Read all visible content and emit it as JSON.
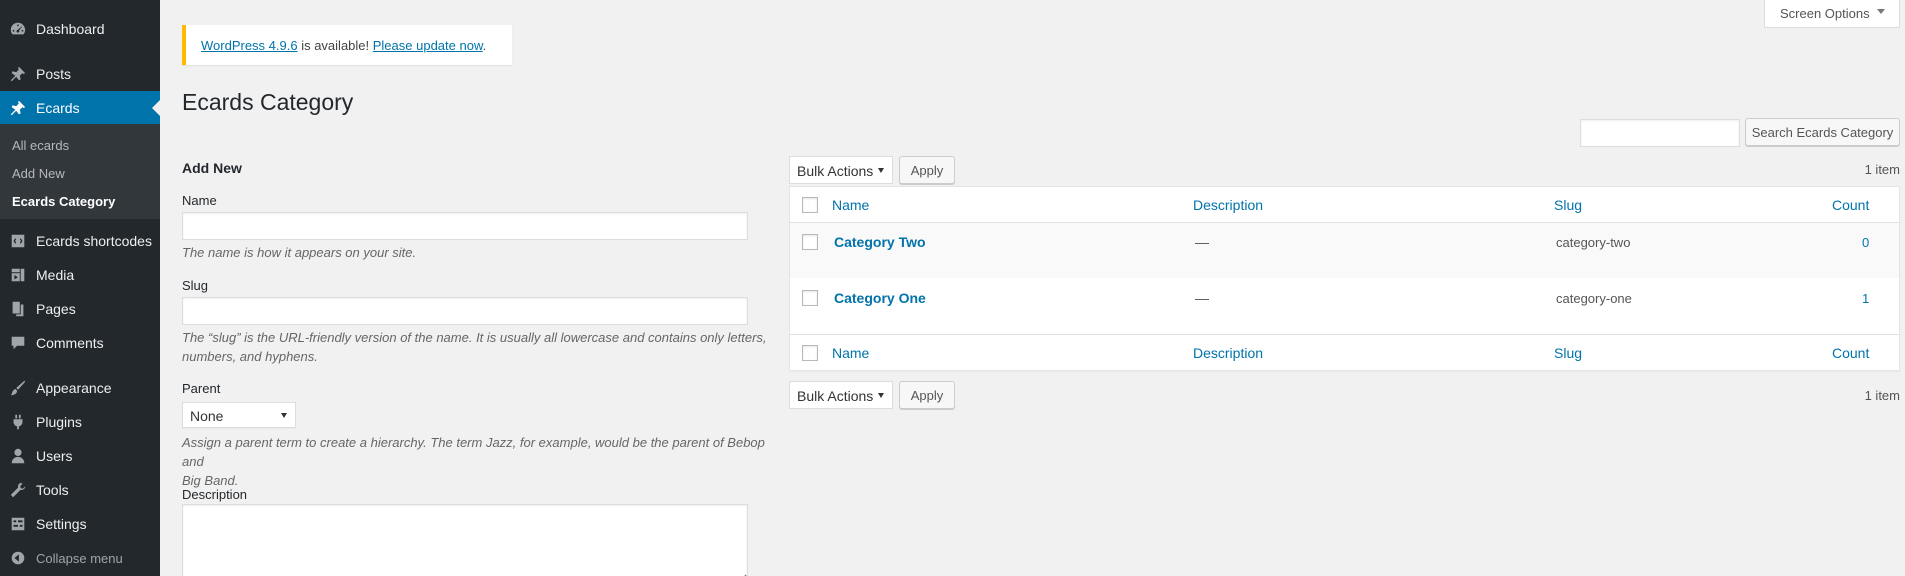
{
  "sidebar": {
    "items": [
      {
        "label": "Dashboard",
        "icon": "dashboard-icon"
      },
      {
        "label": "Posts",
        "icon": "pin-icon"
      },
      {
        "label": "Ecards",
        "icon": "pin-icon"
      },
      {
        "label": "Ecards shortcodes",
        "icon": "shortcode-icon"
      },
      {
        "label": "Media",
        "icon": "media-icon"
      },
      {
        "label": "Pages",
        "icon": "pages-icon"
      },
      {
        "label": "Comments",
        "icon": "comment-icon"
      },
      {
        "label": "Appearance",
        "icon": "brush-icon"
      },
      {
        "label": "Plugins",
        "icon": "plugin-icon"
      },
      {
        "label": "Users",
        "icon": "user-icon"
      },
      {
        "label": "Tools",
        "icon": "wrench-icon"
      },
      {
        "label": "Settings",
        "icon": "settings-icon"
      }
    ],
    "submenu": [
      "All ecards",
      "Add New",
      "Ecards Category"
    ],
    "collapse_label": "Collapse menu",
    "accent": "#0073aa",
    "bg": "#23282d"
  },
  "notice": {
    "version_link": "WordPress 4.9.6",
    "middle": " is available! ",
    "update_link": "Please update now",
    "end": ".",
    "border_color": "#ffb900"
  },
  "screen_options": "Screen Options",
  "page_title": "Ecards Category",
  "search": {
    "placeholder": "",
    "button": "Search Ecards Category"
  },
  "form": {
    "heading": "Add New",
    "name_label": "Name",
    "name_value": "",
    "name_help": "The name is how it appears on your site.",
    "slug_label": "Slug",
    "slug_value": "",
    "slug_help_1": "The “slug” is the URL-friendly version of the name. It is usually all lowercase and contains only letters,",
    "slug_help_2": "numbers, and hyphens.",
    "parent_label": "Parent",
    "parent_value": "None",
    "parent_help_1": "Assign a parent term to create a hierarchy. The term Jazz, for example, would be the parent of Bebop and",
    "parent_help_2": "Big Band.",
    "description_label": "Description"
  },
  "bulk": {
    "select": "Bulk Actions",
    "apply": "Apply",
    "items_count": "1 item"
  },
  "table": {
    "columns": [
      "Name",
      "Description",
      "Slug",
      "Count"
    ],
    "rows": [
      {
        "name": "Category Two",
        "description": "—",
        "slug": "category-two",
        "count": "0"
      },
      {
        "name": "Category One",
        "description": "—",
        "slug": "category-one",
        "count": "1"
      }
    ]
  }
}
